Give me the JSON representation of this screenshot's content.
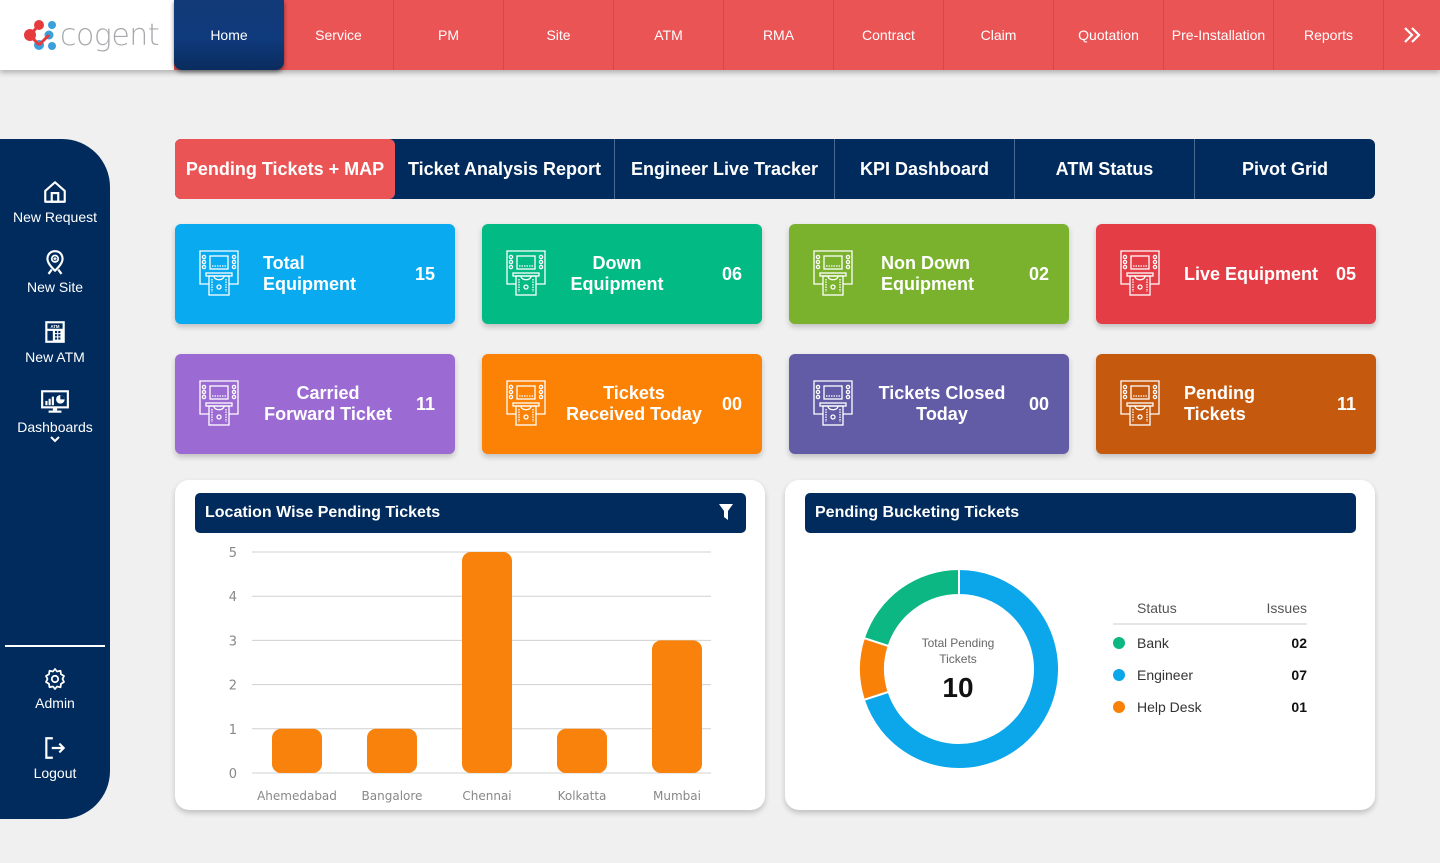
{
  "brand": {
    "name": "cogent"
  },
  "nav": {
    "items": [
      "Home",
      "Service",
      "PM",
      "Site",
      "ATM",
      "RMA",
      "Contract",
      "Claim",
      "Quotation",
      "Pre-Installation",
      "Reports"
    ],
    "active": "Home",
    "more_icon": "double-chevron-right-icon"
  },
  "sidebar": {
    "items": [
      {
        "label": "New Request",
        "icon": "home-icon"
      },
      {
        "label": "New Site",
        "icon": "location-pin-icon"
      },
      {
        "label": "New ATM",
        "icon": "atm-icon"
      },
      {
        "label": "Dashboards",
        "icon": "dashboard-monitor-icon"
      },
      {
        "label": "Admin",
        "icon": "gear-icon"
      },
      {
        "label": "Logout",
        "icon": "logout-icon"
      }
    ]
  },
  "tabs": {
    "items": [
      "Pending Tickets + MAP",
      "Ticket Analysis Report",
      "Engineer Live Tracker",
      "KPI Dashboard",
      "ATM Status",
      "Pivot Grid"
    ],
    "active": "Pending Tickets + MAP"
  },
  "cards": [
    {
      "label": "Total Equipment",
      "value": "15",
      "color": "#09aaf0"
    },
    {
      "label": "Down Equipment",
      "value": "06",
      "color": "#02bb84"
    },
    {
      "label": "Non Down Equipment",
      "value": "02",
      "color": "#7ab22d"
    },
    {
      "label": "Live Equipment",
      "value": "05",
      "color": "#e43d45"
    },
    {
      "label": "Carried Forward Ticket",
      "value": "11",
      "color": "#9b6ad2"
    },
    {
      "label": "Tickets Received Today",
      "value": "00",
      "color": "#fb8204"
    },
    {
      "label": "Tickets Closed Today",
      "value": "00",
      "color": "#625ca6"
    },
    {
      "label": "Pending Tickets",
      "value": "11",
      "color": "#c5590d"
    }
  ],
  "location_panel": {
    "title": "Location Wise Pending Tickets",
    "filter_icon": "filter-icon"
  },
  "bucket_panel": {
    "title": "Pending Bucketing Tickets",
    "center_label": "Total Pending Tickets",
    "center_value": "10",
    "table_headers": [
      "Status",
      "Issues"
    ],
    "rows": [
      {
        "name": "Bank",
        "value": "02",
        "color": "#0cb784"
      },
      {
        "name": "Engineer",
        "value": "07",
        "color": "#0ca6ea"
      },
      {
        "name": "Help Desk",
        "value": "01",
        "color": "#f98108"
      }
    ]
  },
  "chart_data": [
    {
      "type": "bar",
      "title": "Location Wise Pending Tickets",
      "categories": [
        "Ahemedabad",
        "Bangalore",
        "Chennai",
        "Kolkatta",
        "Mumbai"
      ],
      "values": [
        1,
        1,
        5,
        1,
        3
      ],
      "xlabel": "",
      "ylabel": "",
      "ylim": [
        0,
        5
      ],
      "yticks": [
        0,
        1,
        2,
        3,
        4,
        5
      ],
      "grid": true,
      "color": "#f8820b"
    },
    {
      "type": "pie",
      "title": "Pending Bucketing Tickets",
      "donut": true,
      "labels": [
        "Engineer",
        "Help Desk",
        "Bank"
      ],
      "values": [
        7,
        1,
        2
      ],
      "colors": [
        "#0ca6ea",
        "#f98108",
        "#0cb784"
      ],
      "center_text": "Total Pending Tickets 10"
    }
  ]
}
